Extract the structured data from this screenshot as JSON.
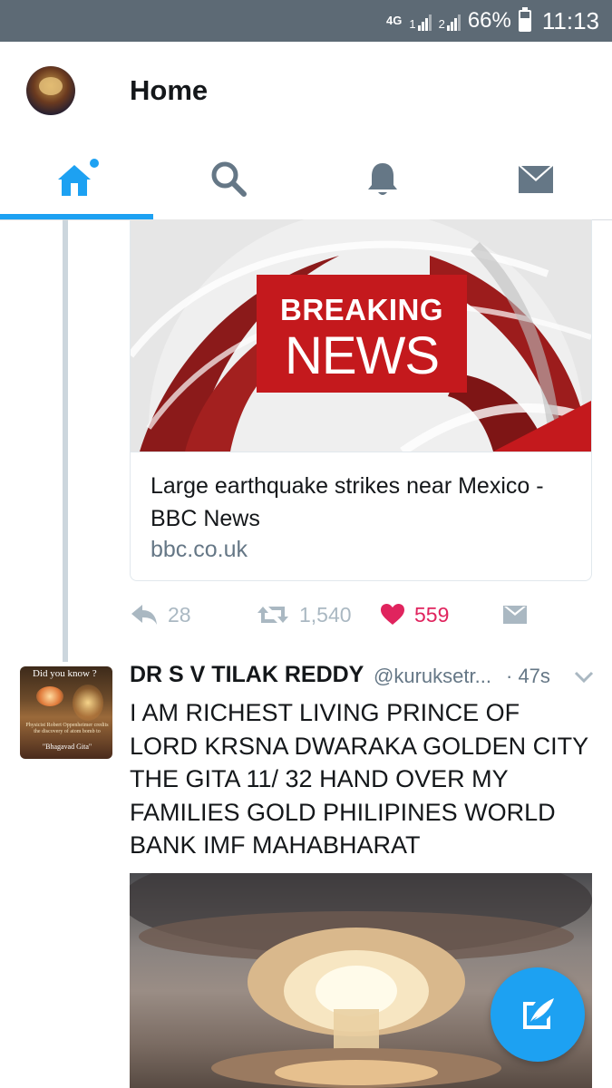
{
  "status_bar": {
    "network": "4G",
    "sim1_label": "1",
    "sim2_label": "2",
    "battery_percent": "66%",
    "battery_level": 0.66,
    "time": "11:13"
  },
  "header": {
    "title": "Home"
  },
  "tabs": [
    {
      "name": "home",
      "icon": "home-icon",
      "active": true,
      "has_dot": true
    },
    {
      "name": "search",
      "icon": "search-icon",
      "active": false
    },
    {
      "name": "notifications",
      "icon": "bell-icon",
      "active": false
    },
    {
      "name": "messages",
      "icon": "envelope-icon",
      "active": false
    }
  ],
  "tweet1": {
    "card": {
      "image_text_line1": "BREAKING",
      "image_text_line2": "NEWS",
      "title": "Large earthquake strikes near Mexico - BBC News",
      "domain": "bbc.co.uk"
    },
    "actions": {
      "replies": "28",
      "retweets": "1,540",
      "likes": "559"
    }
  },
  "tweet2": {
    "avatar_text_top": "Did you know ?",
    "avatar_text_mid": "Physicist Robert Oppenheimer credits the discovery of atom bomb to",
    "avatar_text_bottom": "\"Bhagavad Gita\"",
    "name": "DR S V TILAK REDDY",
    "handle": "@kuruksetr...",
    "time": "· 47s",
    "body": "I AM RICHEST LIVING PRINCE OF LORD KRSNA DWARAKA GOLDEN CITY THE GITA 11/ 32 HAND OVER MY FAMILIES GOLD PHILIPINES WORLD BANK IMF MAHABHARAT"
  },
  "colors": {
    "accent": "#1da1f2",
    "like": "#e0245e",
    "status_bar": "#5d6a75",
    "breaking_red": "#c4191d"
  }
}
